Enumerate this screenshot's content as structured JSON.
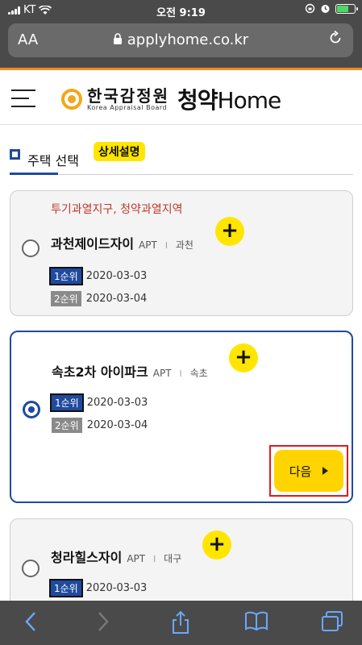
{
  "status_bar": {
    "carrier": "KT",
    "time": "오전 9:19"
  },
  "browser": {
    "text_size_label": "AA",
    "url": "applyhome.co.kr"
  },
  "site": {
    "logo_korean": "한국감정원",
    "logo_english": "Korea Appraisal Board",
    "brand_korean": "청약",
    "brand_latin": "Home"
  },
  "tabs": {
    "active_label": "주택 선택",
    "detail_button": "상세설명"
  },
  "listings": [
    {
      "notice": "투기과열지구, 청약과열지역",
      "name": "과천제이드자이",
      "type": "APT",
      "separator": "l",
      "region": "과천",
      "rank1_label": "1순위",
      "rank1_date": "2020-03-03",
      "rank2_label": "2순위",
      "rank2_date": "2020-03-04",
      "selected": false
    },
    {
      "name": "속초2차 아이파크",
      "type": "APT",
      "separator": "l",
      "region": "속초",
      "rank1_label": "1순위",
      "rank1_date": "2020-03-03",
      "rank2_label": "2순위",
      "rank2_date": "2020-03-04",
      "selected": true
    },
    {
      "name": "청라힐스자이",
      "type": "APT",
      "separator": "l",
      "region": "대구",
      "rank1_label": "1순위",
      "rank1_date": "2020-03-03",
      "selected": false
    }
  ],
  "next_button": {
    "label": "다음"
  },
  "icons": {
    "wifi": "wifi-icon",
    "lock": "lock-icon",
    "reload": "reload-icon",
    "plus": "plus-icon",
    "back": "back-icon",
    "forward": "forward-icon",
    "share": "share-icon",
    "bookmarks": "bookmarks-icon",
    "tabs": "tabs-icon"
  },
  "colors": {
    "accent_blue": "#1f4a9e",
    "yellow": "#ffe600",
    "notice_red": "#c0392b",
    "highlight_red": "#e0191e",
    "orange": "#f08a1f"
  }
}
